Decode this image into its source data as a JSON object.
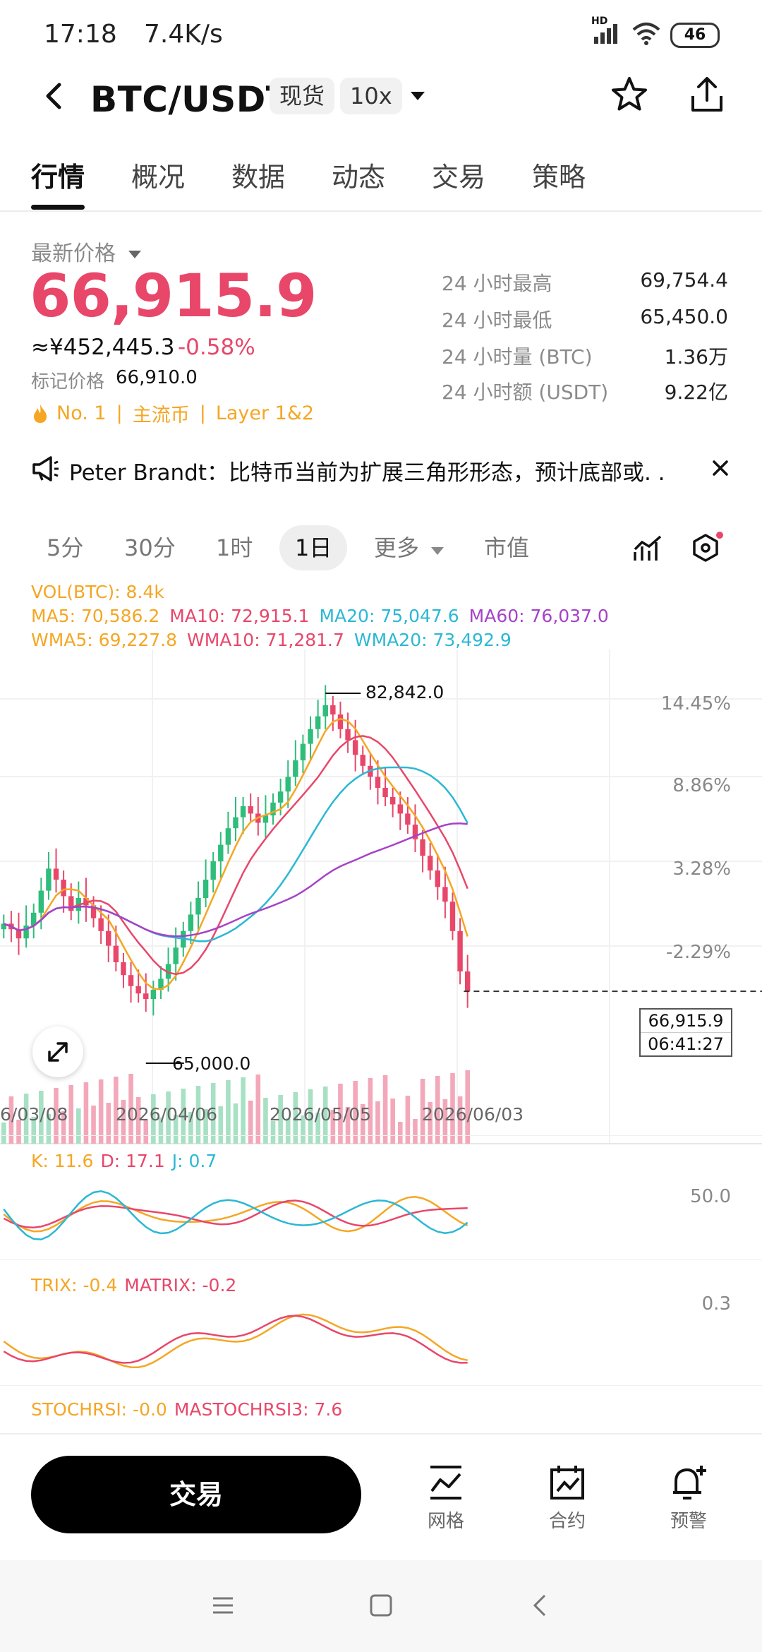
{
  "status_bar": {
    "time": "17:18",
    "net_speed": "7.4K/s",
    "battery": "46",
    "signal_label": "HD"
  },
  "header": {
    "pair": "BTC/USDT",
    "market_chip": "现货",
    "leverage_chip": "10x"
  },
  "tabs": [
    {
      "label": "行情",
      "active": true
    },
    {
      "label": "概况"
    },
    {
      "label": "数据"
    },
    {
      "label": "动态"
    },
    {
      "label": "交易"
    },
    {
      "label": "策略"
    }
  ],
  "price": {
    "label": "最新价格",
    "last": "66,915.9",
    "cny": "≈¥452,445.3",
    "change": "-0.58%",
    "mark_label": "标记价格",
    "mark_value": "66,910.0",
    "rank_tag": "No. 1",
    "tag2": "主流币",
    "tag3": "Layer 1&2",
    "color_down": "#e8476a"
  },
  "stats": [
    {
      "label": "24 小时最高",
      "value": "69,754.4"
    },
    {
      "label": "24 小时最低",
      "value": "65,450.0"
    },
    {
      "label": "24 小时量 (BTC)",
      "value": "1.36万"
    },
    {
      "label": "24 小时额 (USDT)",
      "value": "9.22亿"
    }
  ],
  "announcement": {
    "text": "Peter Brandt：比特币当前为扩展三角形形态，预计底部或. ."
  },
  "ranges": [
    {
      "label": "5分"
    },
    {
      "label": "30分"
    },
    {
      "label": "1时"
    },
    {
      "label": "1日",
      "active": true
    },
    {
      "label": "更多"
    },
    {
      "label": "市值"
    }
  ],
  "indicators": {
    "vol": "VOL(BTC): 8.4k",
    "ma5": "MA5: 70,586.2",
    "ma10": "MA10: 72,915.1",
    "ma20": "MA20: 75,047.6",
    "ma60": "MA60: 76,037.0",
    "wma5": "WMA5: 69,227.8",
    "wma10": "WMA10: 71,281.7",
    "wma20": "WMA20: 73,492.9"
  },
  "chart_data": {
    "type": "candlestick",
    "x_ticks": [
      "6/03/08",
      "2026/04/06",
      "2026/05/05",
      "2026/06/03"
    ],
    "right_axis_ticks": [
      "14.45%",
      "8.86%",
      "3.28%",
      "-2.29%"
    ],
    "high_annotation": "82,842.0",
    "low_annotation": "65,000.0",
    "last_price_box": "66,915.9",
    "countdown_box": "06:41:27",
    "series_colors": {
      "ma5": "#f5a623",
      "ma10": "#e8476a",
      "ma20": "#2bb8d4",
      "ma60": "#a642c7",
      "up": "#2ebd7a",
      "down": "#e8476a"
    },
    "closes": [
      70600,
      70300,
      69800,
      70500,
      71200,
      72400,
      73600,
      73000,
      72100,
      71300,
      72000,
      71600,
      70900,
      70200,
      69400,
      68500,
      67800,
      67200,
      66800,
      66500,
      67000,
      67600,
      68400,
      69300,
      70200,
      71100,
      72000,
      73000,
      74000,
      74900,
      75800,
      76400,
      77000,
      76600,
      76100,
      76500,
      77200,
      77800,
      78600,
      79500,
      80400,
      81200,
      81900,
      82500,
      82000,
      81200,
      80600,
      79800,
      79200,
      78600,
      78000,
      77500,
      77100,
      76600,
      76000,
      75200,
      74300,
      73500,
      72600,
      71800,
      70200,
      68000,
      66915.9
    ],
    "kdj": {
      "k": "K: 11.6",
      "d": "D: 17.1",
      "j": "J: 0.7",
      "axis": "50.0"
    },
    "trix": {
      "trix": "TRIX: -0.4",
      "matrix": "MATRIX: -0.2",
      "axis": "0.3"
    },
    "stochrsi": {
      "stochrsi": "STOCHRSI: -0.0",
      "mastochrsi": "MASTOCHRSI3: 7.6"
    }
  },
  "bottom_bar": {
    "trade_label": "交易",
    "grid_label": "网格",
    "contract_label": "合约",
    "alert_label": "预警"
  }
}
